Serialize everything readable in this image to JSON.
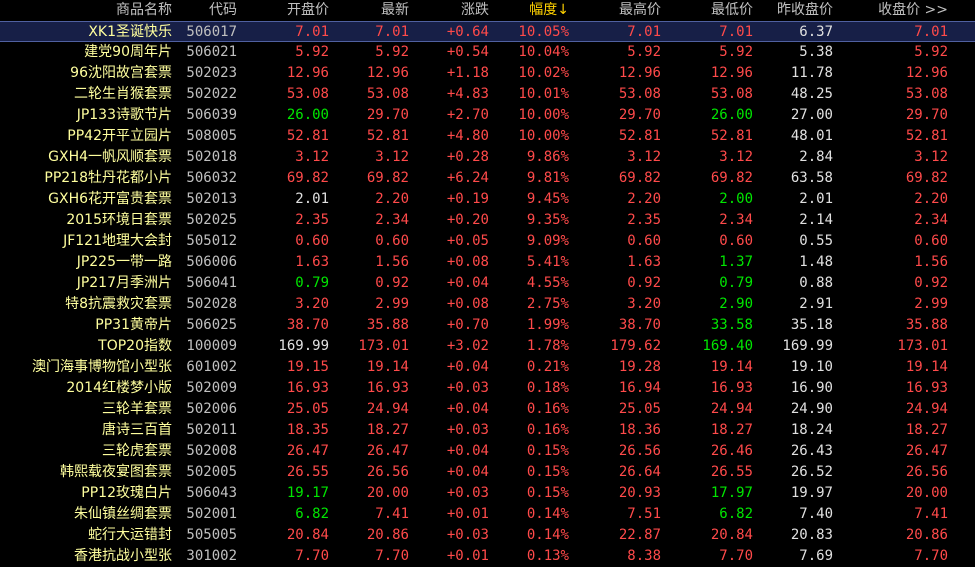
{
  "header": {
    "name": "商品名称",
    "code": "代码",
    "open": "开盘价",
    "latest": "最新",
    "change": "涨跌",
    "pct": "幅度",
    "sort_arrow": "↓",
    "high": "最高价",
    "low": "最低价",
    "prev": "昨收盘价",
    "close": "收盘价 >>"
  },
  "colors": {
    "up": "#ff4a4a",
    "down": "#00e600",
    "flat": "#e0e0e0",
    "name": "#ffff9e",
    "sort_header": "#ffd200",
    "selected_row_bg": "#171f47"
  },
  "rows": [
    {
      "name": "XK1圣诞快乐",
      "code": "506017",
      "open": "7.01",
      "latest": "7.01",
      "change": "+0.64",
      "pct": "10.05%",
      "high": "7.01",
      "low": "7.01",
      "prev": "6.37",
      "close": "7.01",
      "selected": true
    },
    {
      "name": "建党90周年片",
      "code": "506021",
      "open": "5.92",
      "latest": "5.92",
      "change": "+0.54",
      "pct": "10.04%",
      "high": "5.92",
      "low": "5.92",
      "prev": "5.38",
      "close": "5.92"
    },
    {
      "name": "96沈阳故宫套票",
      "code": "502023",
      "open": "12.96",
      "latest": "12.96",
      "change": "+1.18",
      "pct": "10.02%",
      "high": "12.96",
      "low": "12.96",
      "prev": "11.78",
      "close": "12.96"
    },
    {
      "name": "二轮生肖猴套票",
      "code": "502022",
      "open": "53.08",
      "latest": "53.08",
      "change": "+4.83",
      "pct": "10.01%",
      "high": "53.08",
      "low": "53.08",
      "prev": "48.25",
      "close": "53.08"
    },
    {
      "name": "JP133诗歌节片",
      "code": "506039",
      "open": "26.00",
      "latest": "29.70",
      "change": "+2.70",
      "pct": "10.00%",
      "high": "29.70",
      "low": "26.00",
      "prev": "27.00",
      "close": "29.70"
    },
    {
      "name": "PP42开平立园片",
      "code": "508005",
      "open": "52.81",
      "latest": "52.81",
      "change": "+4.80",
      "pct": "10.00%",
      "high": "52.81",
      "low": "52.81",
      "prev": "48.01",
      "close": "52.81"
    },
    {
      "name": "GXH4一帆风顺套票",
      "code": "502018",
      "open": "3.12",
      "latest": "3.12",
      "change": "+0.28",
      "pct": "9.86%",
      "high": "3.12",
      "low": "3.12",
      "prev": "2.84",
      "close": "3.12"
    },
    {
      "name": "PP218牡丹花都小片",
      "code": "506032",
      "open": "69.82",
      "latest": "69.82",
      "change": "+6.24",
      "pct": "9.81%",
      "high": "69.82",
      "low": "69.82",
      "prev": "63.58",
      "close": "69.82"
    },
    {
      "name": "GXH6花开富贵套票",
      "code": "502013",
      "open": "2.01",
      "latest": "2.20",
      "change": "+0.19",
      "pct": "9.45%",
      "high": "2.20",
      "low": "2.00",
      "prev": "2.01",
      "close": "2.20"
    },
    {
      "name": "2015环境日套票",
      "code": "502025",
      "open": "2.35",
      "latest": "2.34",
      "change": "+0.20",
      "pct": "9.35%",
      "high": "2.35",
      "low": "2.34",
      "prev": "2.14",
      "close": "2.34"
    },
    {
      "name": "JF121地理大会封",
      "code": "505012",
      "open": "0.60",
      "latest": "0.60",
      "change": "+0.05",
      "pct": "9.09%",
      "high": "0.60",
      "low": "0.60",
      "prev": "0.55",
      "close": "0.60"
    },
    {
      "name": "JP225一带一路",
      "code": "506006",
      "open": "1.63",
      "latest": "1.56",
      "change": "+0.08",
      "pct": "5.41%",
      "high": "1.63",
      "low": "1.37",
      "prev": "1.48",
      "close": "1.56"
    },
    {
      "name": "JP217月季洲片",
      "code": "506041",
      "open": "0.79",
      "latest": "0.92",
      "change": "+0.04",
      "pct": "4.55%",
      "high": "0.92",
      "low": "0.79",
      "prev": "0.88",
      "close": "0.92"
    },
    {
      "name": "特8抗震救灾套票",
      "code": "502028",
      "open": "3.20",
      "latest": "2.99",
      "change": "+0.08",
      "pct": "2.75%",
      "high": "3.20",
      "low": "2.90",
      "prev": "2.91",
      "close": "2.99"
    },
    {
      "name": "PP31黄帝片",
      "code": "506025",
      "open": "38.70",
      "latest": "35.88",
      "change": "+0.70",
      "pct": "1.99%",
      "high": "38.70",
      "low": "33.58",
      "prev": "35.18",
      "close": "35.88"
    },
    {
      "name": "TOP20指数",
      "code": "100009",
      "open": "169.99",
      "latest": "173.01",
      "change": "+3.02",
      "pct": "1.78%",
      "high": "179.62",
      "low": "169.40",
      "prev": "169.99",
      "close": "173.01"
    },
    {
      "name": "澳门海事博物馆小型张",
      "code": "601002",
      "open": "19.15",
      "latest": "19.14",
      "change": "+0.04",
      "pct": "0.21%",
      "high": "19.28",
      "low": "19.14",
      "prev": "19.10",
      "close": "19.14"
    },
    {
      "name": "2014红楼梦小版",
      "code": "502009",
      "open": "16.93",
      "latest": "16.93",
      "change": "+0.03",
      "pct": "0.18%",
      "high": "16.94",
      "low": "16.93",
      "prev": "16.90",
      "close": "16.93"
    },
    {
      "name": "三轮羊套票",
      "code": "502006",
      "open": "25.05",
      "latest": "24.94",
      "change": "+0.04",
      "pct": "0.16%",
      "high": "25.05",
      "low": "24.94",
      "prev": "24.90",
      "close": "24.94"
    },
    {
      "name": "唐诗三百首",
      "code": "502011",
      "open": "18.35",
      "latest": "18.27",
      "change": "+0.03",
      "pct": "0.16%",
      "high": "18.36",
      "low": "18.27",
      "prev": "18.24",
      "close": "18.27"
    },
    {
      "name": "三轮虎套票",
      "code": "502008",
      "open": "26.47",
      "latest": "26.47",
      "change": "+0.04",
      "pct": "0.15%",
      "high": "26.56",
      "low": "26.46",
      "prev": "26.43",
      "close": "26.47"
    },
    {
      "name": "韩熙载夜宴图套票",
      "code": "502005",
      "open": "26.55",
      "latest": "26.56",
      "change": "+0.04",
      "pct": "0.15%",
      "high": "26.64",
      "low": "26.55",
      "prev": "26.52",
      "close": "26.56"
    },
    {
      "name": "PP12玫瑰白片",
      "code": "506043",
      "open": "19.17",
      "latest": "20.00",
      "change": "+0.03",
      "pct": "0.15%",
      "high": "20.93",
      "low": "17.97",
      "prev": "19.97",
      "close": "20.00"
    },
    {
      "name": "朱仙镇丝绸套票",
      "code": "502001",
      "open": "6.82",
      "latest": "7.41",
      "change": "+0.01",
      "pct": "0.14%",
      "high": "7.51",
      "low": "6.82",
      "prev": "7.40",
      "close": "7.41"
    },
    {
      "name": "蛇行大运错封",
      "code": "505005",
      "open": "20.84",
      "latest": "20.86",
      "change": "+0.03",
      "pct": "0.14%",
      "high": "22.87",
      "low": "20.84",
      "prev": "20.83",
      "close": "20.86"
    },
    {
      "name": "香港抗战小型张",
      "code": "301002",
      "open": "7.70",
      "latest": "7.70",
      "change": "+0.01",
      "pct": "0.13%",
      "high": "8.38",
      "low": "7.70",
      "prev": "7.69",
      "close": "7.70"
    }
  ]
}
